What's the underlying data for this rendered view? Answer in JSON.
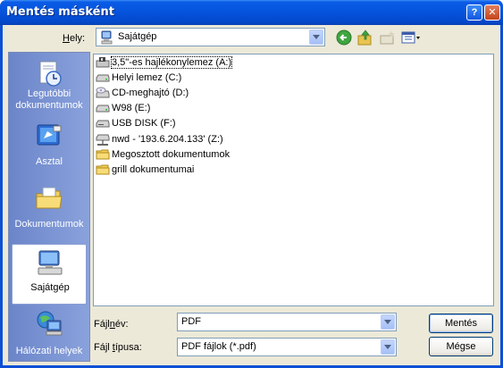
{
  "window": {
    "title": "Mentés másként",
    "help_label": "?",
    "close_label": "✕"
  },
  "location": {
    "label_prefix": "",
    "label_accel": "H",
    "label_rest": "ely:",
    "value": "Sajátgép",
    "icon": "computer-icon"
  },
  "toolbar": {
    "back_icon": "back-arrow-icon",
    "up_icon": "up-folder-icon",
    "new_folder_icon": "new-folder-icon",
    "views_icon": "views-menu-icon"
  },
  "places": [
    {
      "label": "Legutóbbi dokumentumok",
      "icon": "recent-documents-icon",
      "selected": false
    },
    {
      "label": "Asztal",
      "icon": "desktop-icon",
      "selected": false
    },
    {
      "label": "Dokumentumok",
      "icon": "my-documents-icon",
      "selected": false
    },
    {
      "label": "Sajátgép",
      "icon": "my-computer-icon",
      "selected": true
    },
    {
      "label": "Hálózati helyek",
      "icon": "network-places-icon",
      "selected": false
    }
  ],
  "files": [
    {
      "label": "3,5\"-es hajlékonylemez (A:)",
      "icon": "floppy-drive-icon"
    },
    {
      "label": "Helyi lemez (C:)",
      "icon": "hard-drive-icon"
    },
    {
      "label": "CD-meghajtó (D:)",
      "icon": "cd-drive-icon"
    },
    {
      "label": "W98 (E:)",
      "icon": "hard-drive-icon"
    },
    {
      "label": "USB DISK (F:)",
      "icon": "removable-drive-icon"
    },
    {
      "label": "nwd - '193.6.204.133' (Z:)",
      "icon": "network-drive-icon"
    },
    {
      "label": "Megosztott dokumentumok",
      "icon": "folder-icon"
    },
    {
      "label": "grill dokumentumai",
      "icon": "folder-icon"
    }
  ],
  "filename": {
    "label_pre": "Fájl",
    "label_accel": "n",
    "label_post": "év:",
    "value": "PDF"
  },
  "filetype": {
    "label_pre": "Fájl ",
    "label_accel": "t",
    "label_post": "ípusa:",
    "value": "PDF fájlok (*.pdf)"
  },
  "buttons": {
    "save_label": "Mentés",
    "cancel_label": "Mégse"
  }
}
